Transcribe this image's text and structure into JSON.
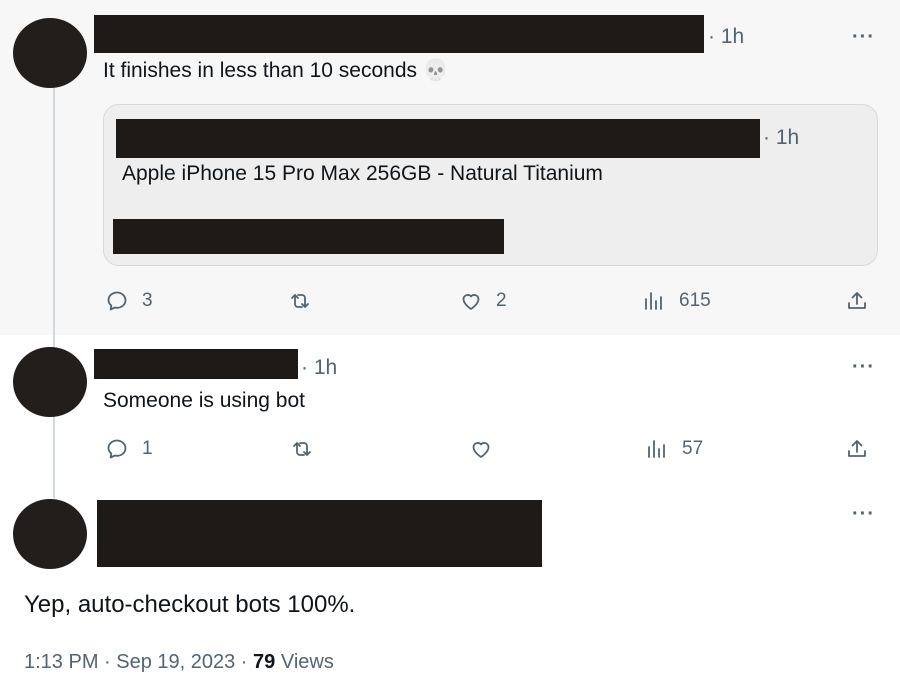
{
  "tweet1": {
    "time": "· 1h",
    "text": "It finishes in less than 10 seconds",
    "emoji": "💀",
    "more": "···",
    "quote": {
      "time": "· 1h",
      "text": "Apple iPhone 15 Pro Max 256GB - Natural Titanium"
    },
    "actions": {
      "replies": "3",
      "reposts": "",
      "likes": "2",
      "views": "615"
    }
  },
  "tweet2": {
    "time": "· 1h",
    "text": "Someone is using bot",
    "more": "···",
    "actions": {
      "replies": "1",
      "reposts": "",
      "likes": "",
      "views": "57"
    }
  },
  "tweet3": {
    "more": "···",
    "text": "Yep, auto-checkout bots 100%.",
    "timestamp": "1:13 PM · Sep 19, 2023 · ",
    "views_count": "79",
    "views_label": " Views"
  },
  "icons": [
    "reply-icon",
    "repost-icon",
    "like-icon",
    "views-icon",
    "share-icon",
    "more-icon"
  ]
}
